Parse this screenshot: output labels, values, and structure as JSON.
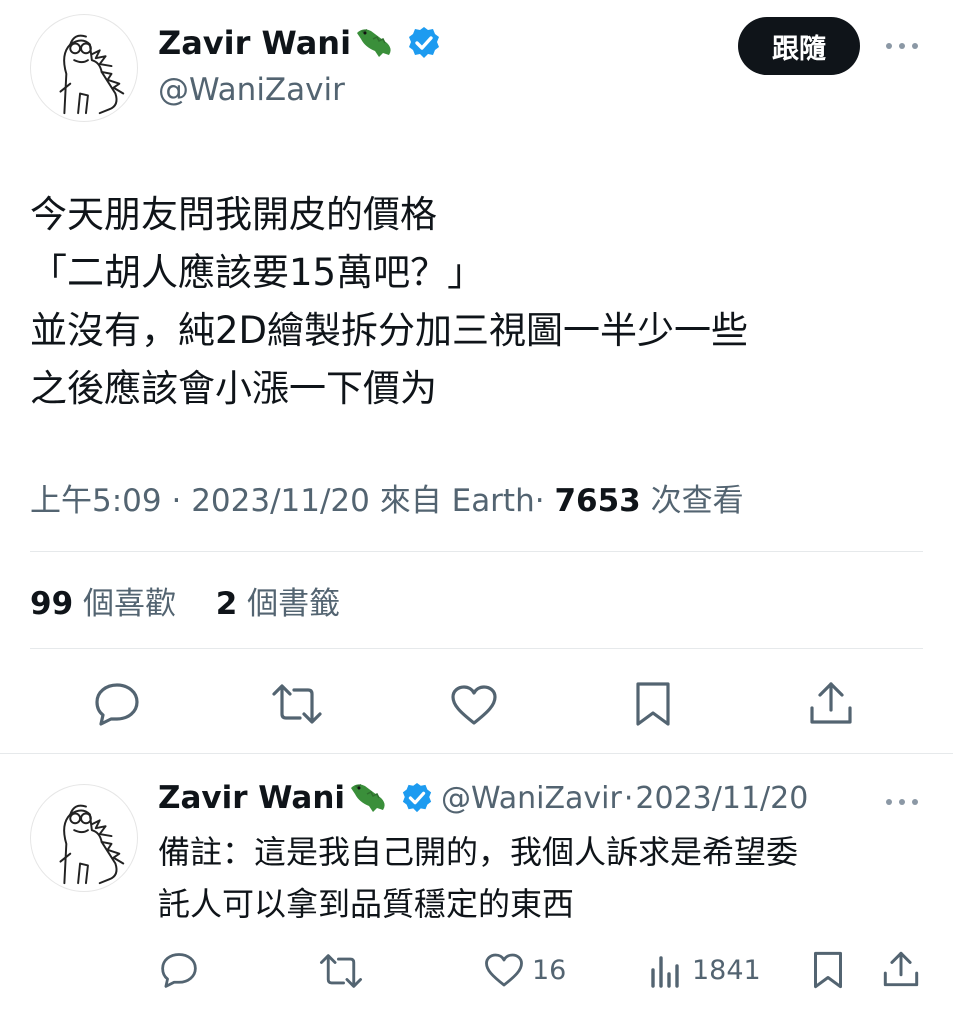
{
  "tweet": {
    "author_name": "Zavir Wani",
    "author_handle": "@WaniZavir",
    "follow_label": "跟隨",
    "text_lines": [
      "今天朋友問我開皮的價格",
      "「二胡人應該要15萬吧？」",
      "並沒有，純2D繪製拆分加三視圖一半少一些",
      "之後應該會小漲一下價为"
    ],
    "meta": {
      "time": "上午5:09",
      "sep1": "·",
      "date": "2023/11/20",
      "source": "來自 Earth",
      "sep2": "·",
      "views": "7653",
      "views_label": "次查看"
    },
    "stats": {
      "likes": "99",
      "likes_label": "個喜歡",
      "bookmarks": "2",
      "bookmarks_label": "個書籤"
    }
  },
  "reply": {
    "author_name": "Zavir Wani",
    "author_handle": "@WaniZavir",
    "sep": "·",
    "date": "2023/11/20",
    "text_lines": [
      "備註：這是我自己開的，我個人訴求是希望委",
      "託人可以拿到品質穩定的東西"
    ],
    "like_count": "16",
    "view_count": "1841"
  },
  "colors": {
    "text": "#0f1419",
    "secondary": "#536471",
    "verified": "#1d9bf0",
    "croc": "#3a8f3a",
    "divider": "#e6e9eb"
  },
  "icons": [
    "avatar-doodle",
    "crocodile-emoji",
    "verified-badge",
    "more-icon",
    "reply-icon",
    "retweet-icon",
    "like-icon",
    "bookmark-icon",
    "share-icon",
    "views-icon"
  ]
}
